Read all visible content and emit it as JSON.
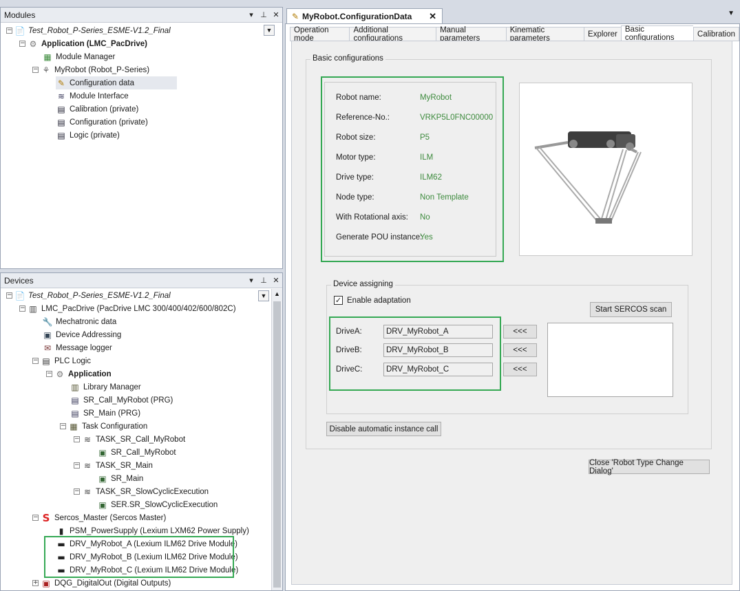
{
  "modules": {
    "title": "Modules",
    "pin": "▾",
    "tack": "⊥",
    "close": "✕",
    "tree": [
      {
        "label": "Test_Robot_P-Series_ESME-V1.2_Final",
        "style": "ital"
      },
      {
        "label": "Application (LMC_PacDrive)",
        "style": "bold"
      },
      {
        "label": "Module Manager"
      },
      {
        "label": "MyRobot (Robot_P-Series)"
      },
      {
        "label": "Configuration data"
      },
      {
        "label": "Module Interface"
      },
      {
        "label": "Calibration (private)"
      },
      {
        "label": "Configuration (private)"
      },
      {
        "label": "Logic (private)"
      }
    ]
  },
  "devices": {
    "title": "Devices",
    "tree": [
      {
        "label": "Test_Robot_P-Series_ESME-V1.2_Final"
      },
      {
        "label": "LMC_PacDrive (PacDrive LMC 300/400/402/600/802C)"
      },
      {
        "label": "Mechatronic data"
      },
      {
        "label": "Device Addressing"
      },
      {
        "label": "Message logger"
      },
      {
        "label": "PLC Logic"
      },
      {
        "label": "Application"
      },
      {
        "label": "Library Manager"
      },
      {
        "label": "SR_Call_MyRobot (PRG)"
      },
      {
        "label": "SR_Main (PRG)"
      },
      {
        "label": "Task Configuration"
      },
      {
        "label": "TASK_SR_Call_MyRobot"
      },
      {
        "label": "SR_Call_MyRobot"
      },
      {
        "label": "TASK_SR_Main"
      },
      {
        "label": "SR_Main"
      },
      {
        "label": "TASK_SR_SlowCyclicExecution"
      },
      {
        "label": "SER.SR_SlowCyclicExecution"
      },
      {
        "label": "Sercos_Master (Sercos Master)"
      },
      {
        "label": "PSM_PowerSupply (Lexium LXM62 Power Supply)"
      },
      {
        "label": "DRV_MyRobot_A (Lexium ILM62 Drive Module)"
      },
      {
        "label": "DRV_MyRobot_B (Lexium ILM62 Drive Module)"
      },
      {
        "label": "DRV_MyRobot_C (Lexium ILM62 Drive Module)"
      },
      {
        "label": "DQG_DigitalOut (Digital Outputs)"
      }
    ]
  },
  "editor": {
    "doc_tab": "MyRobot.ConfigurationData",
    "close": "✕",
    "tabs": [
      "Operation mode",
      "Additional configurations",
      "Manual parameters",
      "Kinematic parameters",
      "Explorer",
      "Basic configurations",
      "Calibration"
    ],
    "active_tab": "Basic configurations",
    "basic": {
      "group_title": "Basic configurations",
      "props": [
        {
          "label": "Robot name:",
          "value": "MyRobot"
        },
        {
          "label": "Reference-No.:",
          "value": "VRKP5L0FNC00000"
        },
        {
          "label": "Robot size:",
          "value": "P5"
        },
        {
          "label": "Motor type:",
          "value": "ILM"
        },
        {
          "label": "Drive type:",
          "value": "ILM62"
        },
        {
          "label": "Node type:",
          "value": "Non Template"
        },
        {
          "label": "With Rotational axis:",
          "value": "No"
        },
        {
          "label": "Generate POU instance:",
          "value": "Yes"
        }
      ]
    },
    "assign": {
      "group_title": "Device assigning",
      "enable_label": "Enable adaptation",
      "enable_checked": "✓",
      "scan_button": "Start SERCOS scan",
      "drives": [
        {
          "label": "DriveA:",
          "value": "DRV_MyRobot_A",
          "btn": "<<<"
        },
        {
          "label": "DriveB:",
          "value": "DRV_MyRobot_B",
          "btn": "<<<"
        },
        {
          "label": "DriveC:",
          "value": "DRV_MyRobot_C",
          "btn": "<<<"
        }
      ]
    },
    "disable_button": "Disable automatic instance call",
    "close_dialog_button": "Close 'Robot Type Change Dialog'"
  },
  "colors": {
    "highlight": "#34a853",
    "value_text": "#3c8a3c"
  }
}
